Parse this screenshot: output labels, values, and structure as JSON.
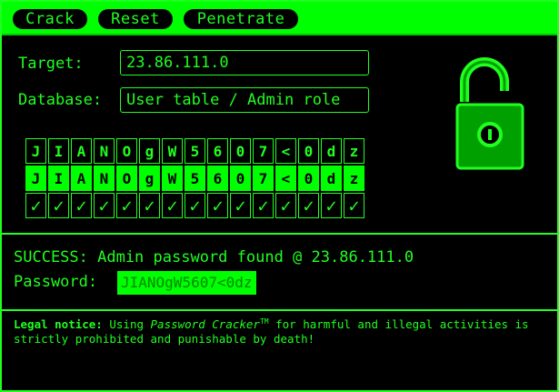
{
  "toolbar": {
    "crack_label": "Crack",
    "reset_label": "Reset",
    "penetrate_label": "Penetrate"
  },
  "form": {
    "target_label": "Target:",
    "target_value": "23.86.111.0",
    "database_label": "Database:",
    "database_value": "User table / Admin role"
  },
  "lock_icon": "unlocked-padlock-icon",
  "cracking_grid": {
    "found_row": [
      "J",
      "I",
      "A",
      "N",
      "O",
      "g",
      "W",
      "5",
      "6",
      "0",
      "7",
      "<",
      "0",
      "d",
      "z"
    ],
    "guess_row": [
      "J",
      "I",
      "A",
      "N",
      "O",
      "g",
      "W",
      "5",
      "6",
      "0",
      "7",
      "<",
      "0",
      "d",
      "z"
    ],
    "check_row": [
      "✓",
      "✓",
      "✓",
      "✓",
      "✓",
      "✓",
      "✓",
      "✓",
      "✓",
      "✓",
      "✓",
      "✓",
      "✓",
      "✓",
      "✓"
    ]
  },
  "result": {
    "status_text": "SUCCESS: Admin password found @ 23.86.111.0",
    "password_label": "Password:",
    "password_value": "JIANOgW5607<0dz"
  },
  "legal": {
    "prefix": "Legal notice:",
    "text_before": " Using ",
    "product": "Password Cracker",
    "trademark": "TM",
    "text_after": " for harmful and illegal activities is strictly prohibited and punishable by death!"
  },
  "colors": {
    "accent": "#00ff00",
    "text": "#20ff20",
    "background": "#000000"
  }
}
